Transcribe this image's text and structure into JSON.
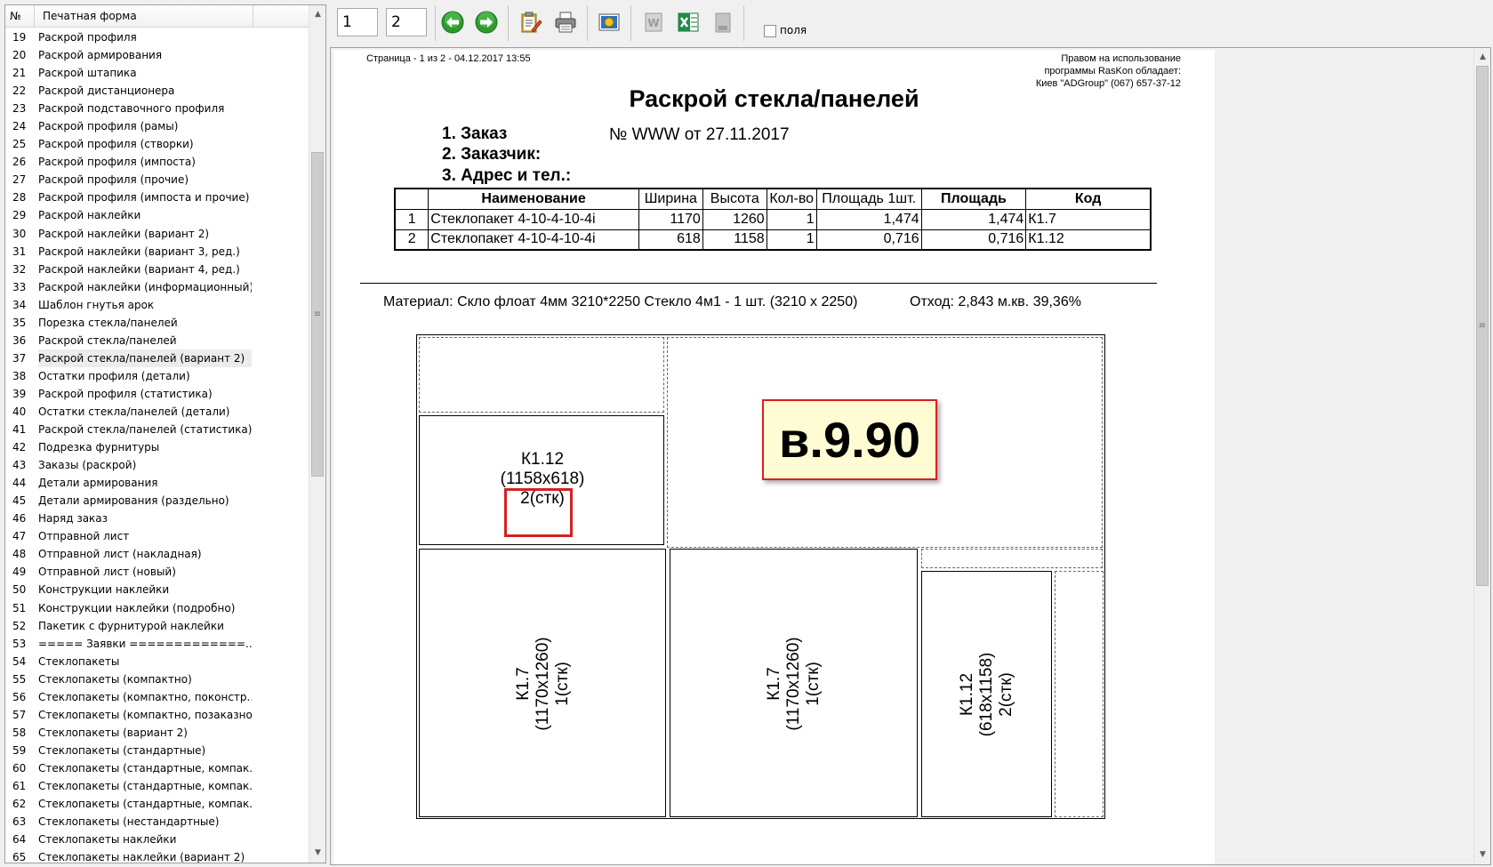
{
  "list": {
    "header": {
      "num": "№",
      "name": "Печатная форма"
    },
    "selected": "37",
    "items": [
      {
        "num": "19",
        "name": "Раскрой профиля"
      },
      {
        "num": "20",
        "name": "Раскрой армирования"
      },
      {
        "num": "21",
        "name": "Раскрой штапика"
      },
      {
        "num": "22",
        "name": "Раскрой дистанционера"
      },
      {
        "num": "23",
        "name": "Раскрой подставочного профиля"
      },
      {
        "num": "24",
        "name": "Раскрой профиля (рамы)"
      },
      {
        "num": "25",
        "name": "Раскрой профиля (створки)"
      },
      {
        "num": "26",
        "name": "Раскрой профиля (импоста)"
      },
      {
        "num": "27",
        "name": "Раскрой профиля (прочие)"
      },
      {
        "num": "28",
        "name": "Раскрой профиля (импоста и прочие)"
      },
      {
        "num": "29",
        "name": "Раскрой наклейки"
      },
      {
        "num": "30",
        "name": "Раскрой наклейки (вариант 2)"
      },
      {
        "num": "31",
        "name": "Раскрой наклейки (вариант 3, ред.)"
      },
      {
        "num": "32",
        "name": "Раскрой наклейки (вариант 4, ред.)"
      },
      {
        "num": "33",
        "name": "Раскрой наклейки (информационный)"
      },
      {
        "num": "34",
        "name": "Шаблон гнутья арок"
      },
      {
        "num": "35",
        "name": "Порезка стекла/панелей"
      },
      {
        "num": "36",
        "name": "Раскрой стекла/панелей"
      },
      {
        "num": "37",
        "name": "Раскрой стекла/панелей (вариант 2)"
      },
      {
        "num": "38",
        "name": "Остатки профиля (детали)"
      },
      {
        "num": "39",
        "name": "Раскрой профиля (статистика)"
      },
      {
        "num": "40",
        "name": "Остатки стекла/панелей (детали)"
      },
      {
        "num": "41",
        "name": "Раскрой стекла/панелей (статистика)"
      },
      {
        "num": "42",
        "name": "Подрезка фурнитуры"
      },
      {
        "num": "43",
        "name": "Заказы (раскрой)"
      },
      {
        "num": "44",
        "name": "Детали армирования"
      },
      {
        "num": "45",
        "name": "Детали армирования (раздельно)"
      },
      {
        "num": "46",
        "name": "Наряд заказ"
      },
      {
        "num": "47",
        "name": "Отправной лист"
      },
      {
        "num": "48",
        "name": "Отправной лист (накладная)"
      },
      {
        "num": "49",
        "name": "Отправной лист (новый)"
      },
      {
        "num": "50",
        "name": "Конструкции наклейки"
      },
      {
        "num": "51",
        "name": "Конструкции наклейки (подробно)"
      },
      {
        "num": "52",
        "name": "Пакетик с фурнитурой наклейки"
      },
      {
        "num": "53",
        "name": "===== Заявки =============..."
      },
      {
        "num": "54",
        "name": "Стеклопакеты"
      },
      {
        "num": "55",
        "name": "Стеклопакеты (компактно)"
      },
      {
        "num": "56",
        "name": "Стеклопакеты (компактно, поконстр..."
      },
      {
        "num": "57",
        "name": "Стеклопакеты (компактно, позаказно)"
      },
      {
        "num": "58",
        "name": "Стеклопакеты (вариант 2)"
      },
      {
        "num": "59",
        "name": "Стеклопакеты (стандартные)"
      },
      {
        "num": "60",
        "name": "Стеклопакеты (стандартные, компак..."
      },
      {
        "num": "61",
        "name": "Стеклопакеты (стандартные, компак..."
      },
      {
        "num": "62",
        "name": "Стеклопакеты (стандартные, компак..."
      },
      {
        "num": "63",
        "name": "Стеклопакеты (нестандартные)"
      },
      {
        "num": "64",
        "name": "Стеклопакеты наклейки"
      },
      {
        "num": "65",
        "name": "Стеклопакеты наклейки (вариант 2)"
      }
    ]
  },
  "toolbar": {
    "page_from": "1",
    "page_to": "2",
    "fields_label": "поля",
    "icons": [
      "arrow-left-icon",
      "arrow-right-icon",
      "clipboard-edit-icon",
      "printer-icon",
      "image-export-icon",
      "word-export-icon",
      "excel-export-icon",
      "disabled-export-icon"
    ]
  },
  "report": {
    "page_info": "Страница  - 1 из 2 -  04.12.2017 13:55",
    "copyright_1": "Правом на использование",
    "copyright_2": "программы RasKon обладает:",
    "copyright_3": "Киев  \"ADGroup\"  (067) 657-37-12",
    "title": "Раскрой стекла/панелей",
    "order_label": "1. Заказ",
    "order_number": "№ WWW  от 27.11.2017",
    "customer_label": "2. Заказчик:",
    "address_label": "3. Адрес и тел.:",
    "table": {
      "headers": [
        "",
        "Наименование",
        "Ширина",
        "Высота",
        "Кол-во",
        "Площадь 1шт.",
        "Площадь",
        "Код"
      ],
      "rows": [
        [
          "1",
          "Стеклопакет 4-10-4-10-4i",
          "1170",
          "1260",
          "1",
          "1,474",
          "1,474",
          "К1.7"
        ],
        [
          "2",
          "Стеклопакет 4-10-4-10-4i",
          "618",
          "1158",
          "1",
          "0,716",
          "0,716",
          "К1.12"
        ]
      ]
    },
    "material": "Материал: Скло флоат 4мм 3210*2250 Стекло 4м1 - 1 шт. (3210 x 2250)",
    "waste": "Отход: 2,843 м.кв. 39,36%",
    "pieces": [
      {
        "code": "К1.12",
        "size": "(1158x618)",
        "qty": "2(стк)"
      },
      {
        "code": "К1.7",
        "size": "(1170x1260)",
        "qty": "1(стк)"
      },
      {
        "code": "К1.7",
        "size": "(1170x1260)",
        "qty": "1(стк)"
      },
      {
        "code": "К1.12",
        "size": "(618x1158)",
        "qty": "2(стк)"
      }
    ],
    "version_badge": "в.9.90"
  }
}
